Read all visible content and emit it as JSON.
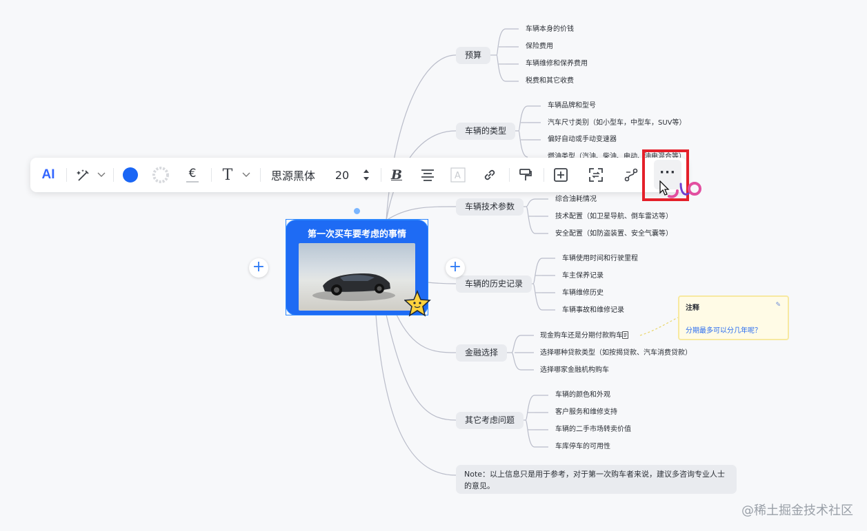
{
  "root": {
    "title": "第一次买车要考虑的事情"
  },
  "branches": [
    {
      "label": "预算",
      "items": [
        "车辆本身的价钱",
        "保险费用",
        "车辆维修和保养费用",
        "税费和其它收费"
      ]
    },
    {
      "label": "车辆的类型",
      "items": [
        "车辆品牌和型号",
        "汽车尺寸类别（如小型车，中型车，SUV等）",
        "偏好自动或手动变速器",
        "燃油类型（汽油、柴油、电动、油电混合等）"
      ]
    },
    {
      "label": "车辆技术参数",
      "items": [
        "综合油耗情况",
        "技术配置（如卫星导航、倒车雷达等）",
        "安全配置（如防盗装置、安全气囊等）"
      ]
    },
    {
      "label": "车辆的历史记录",
      "items": [
        "车辆使用时间和行驶里程",
        "车主保养记录",
        "车辆维修历史",
        "车辆事故和维修记录"
      ]
    },
    {
      "label": "金融选择",
      "items": [
        "现金购车还是分期付款购车",
        "选择哪种贷款类型（如按揭贷款、汽车消费贷款）",
        "选择哪家金融机构购车"
      ]
    },
    {
      "label": "其它考虑问题",
      "items": [
        "车辆的颜色和外观",
        "客户服务和维修支持",
        "车辆的二手市场转卖价值",
        "车库停车的可用性"
      ]
    }
  ],
  "note_node": "Note：以上信息只是用于参考，对于第一次购车者来说，建议多咨询专业人士的意见。",
  "note_card": {
    "title": "注释",
    "text": "分期最多可以分几年呢？"
  },
  "toolbar": {
    "ai_label": "AI",
    "font_name": "思源黑体",
    "font_size": "20",
    "fill_color": "#1a66f5",
    "currency_glyph": "€",
    "text_glyph": "T",
    "more_glyph": "···"
  },
  "watermark": "@稀土掘金技术社区",
  "colors": {
    "accent": "#1e6bf4",
    "highlight": "#e4202a",
    "line": "#b9bcc9"
  }
}
